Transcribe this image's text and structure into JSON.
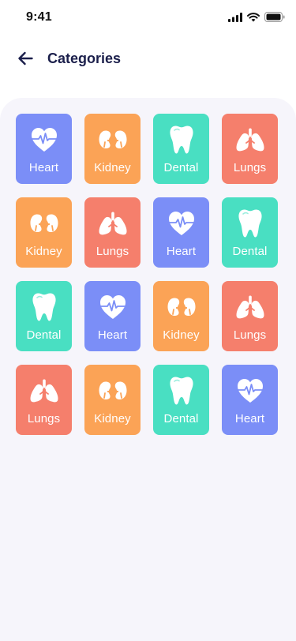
{
  "status_bar": {
    "time": "9:41"
  },
  "header": {
    "title": "Categories"
  },
  "colors": {
    "heart": "#7b8ef7",
    "kidney": "#fba356",
    "dental": "#49dfc2",
    "lungs": "#f57f6c",
    "title": "#1b1f4b",
    "panel": "#f6f5fb"
  },
  "categories": [
    {
      "label": "Heart",
      "icon": "heart-icon",
      "type": "heart"
    },
    {
      "label": "Kidney",
      "icon": "kidney-icon",
      "type": "kidney"
    },
    {
      "label": "Dental",
      "icon": "tooth-icon",
      "type": "dental"
    },
    {
      "label": "Lungs",
      "icon": "lungs-icon",
      "type": "lungs"
    },
    {
      "label": "Kidney",
      "icon": "kidney-icon",
      "type": "kidney"
    },
    {
      "label": "Lungs",
      "icon": "lungs-icon",
      "type": "lungs"
    },
    {
      "label": "Heart",
      "icon": "heart-icon",
      "type": "heart"
    },
    {
      "label": "Dental",
      "icon": "tooth-icon",
      "type": "dental"
    },
    {
      "label": "Dental",
      "icon": "tooth-icon",
      "type": "dental"
    },
    {
      "label": "Heart",
      "icon": "heart-icon",
      "type": "heart"
    },
    {
      "label": "Kidney",
      "icon": "kidney-icon",
      "type": "kidney"
    },
    {
      "label": "Lungs",
      "icon": "lungs-icon",
      "type": "lungs"
    },
    {
      "label": "Lungs",
      "icon": "lungs-icon",
      "type": "lungs"
    },
    {
      "label": "Kidney",
      "icon": "kidney-icon",
      "type": "kidney"
    },
    {
      "label": "Dental",
      "icon": "tooth-icon",
      "type": "dental"
    },
    {
      "label": "Heart",
      "icon": "heart-icon",
      "type": "heart"
    }
  ]
}
